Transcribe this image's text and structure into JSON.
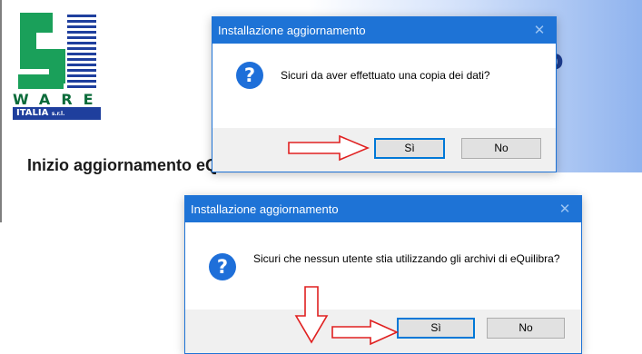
{
  "background": {
    "heading": "Inizio aggiornamento eQuilibra",
    "banner_glyph": "o",
    "logo": {
      "text": "WARE",
      "band_main": "ITALIA",
      "band_suffix": "s.r.l."
    }
  },
  "dialogs": [
    {
      "title": "Installazione aggiornamento",
      "close_glyph": "✕",
      "icon": "question-icon",
      "icon_glyph": "?",
      "message": "Sicuri da aver effettuato una copia dei dati?",
      "yes_label": "Sì",
      "no_label": "No"
    },
    {
      "title": "Installazione aggiornamento",
      "close_glyph": "✕",
      "icon": "question-icon",
      "icon_glyph": "?",
      "message": "Sicuri che nessun utente stia utilizzando gli archivi di eQuilibra?",
      "yes_label": "Sì",
      "no_label": "No"
    }
  ],
  "colors": {
    "titlebar": "#1e73d6",
    "accent_arrow": "#e02020",
    "logo_green": "#0b6b3a",
    "logo_blue": "#1f3f9d"
  }
}
